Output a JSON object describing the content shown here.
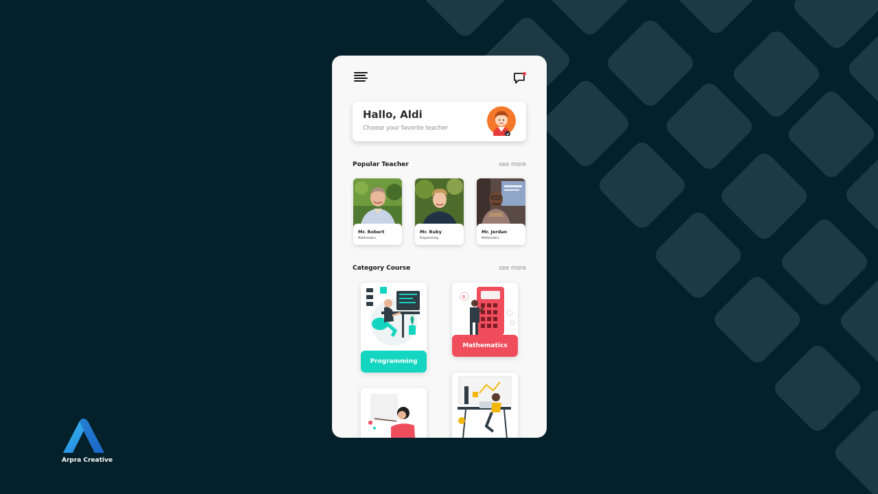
{
  "app": {
    "greeting_title": "Hallo, Aldi",
    "greeting_subtitle": "Choose your favorite teacher"
  },
  "popular_teacher": {
    "title": "Popular Teacher",
    "see_more": "see more",
    "teachers": [
      {
        "name": "Mr. Robert",
        "subject": "Mathematics"
      },
      {
        "name": "Mr. Ruby",
        "subject": "Programming"
      },
      {
        "name": "Mr. Jordan",
        "subject": "Mathematics"
      }
    ]
  },
  "category_course": {
    "title": "Category Course",
    "see_more": "see more",
    "courses": [
      {
        "label": "Programming",
        "color": "#14d6c0"
      },
      {
        "label": "Mathematics",
        "color": "#f04d5c"
      }
    ]
  },
  "brand": {
    "name": "Arpra Creative"
  },
  "colors": {
    "background": "#04202a",
    "pattern": "#1d3a44",
    "accent_teal": "#14d6c0",
    "accent_red": "#f04d5c",
    "notification_dot": "#e63946"
  },
  "icons": {
    "menu": "menu-icon",
    "chat": "chat-icon"
  }
}
